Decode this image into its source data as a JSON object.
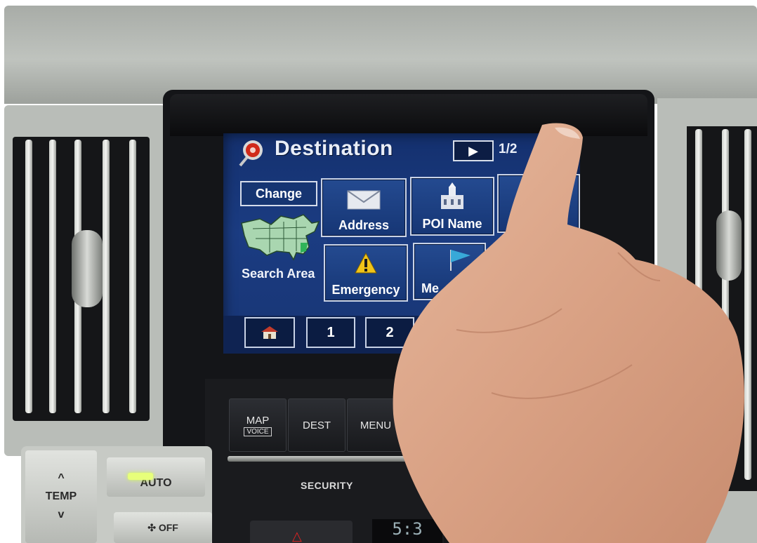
{
  "nav_screen": {
    "title": "Destination",
    "page_indicator": "1/2",
    "next_page_glyph": "▶",
    "change_label": "Change",
    "search_area_label": "Search Area",
    "buttons": [
      {
        "label": "Address",
        "icon": "envelope-icon"
      },
      {
        "label": "POI Name",
        "icon": "building-icon"
      },
      {
        "label": "",
        "icon": "obscured-icon"
      },
      {
        "label": "Emergency",
        "icon": "warning-icon"
      },
      {
        "label": "Me",
        "icon": "flag-icon"
      }
    ],
    "quick_buttons": [
      {
        "label": "",
        "icon": "home-icon"
      },
      {
        "label": "1"
      },
      {
        "label": "2"
      }
    ]
  },
  "hard_buttons": {
    "map": "MAP",
    "voice": "VOICE",
    "dest": "DEST",
    "menu": "MENU",
    "security": "SECURITY"
  },
  "climate": {
    "temp": "TEMP",
    "up": "^",
    "down": "v",
    "auto": "AUTO",
    "ac_off": "OFF"
  },
  "clock": "5:3",
  "colors": {
    "screen_bg": "#1b3c82",
    "button_border": "#c8d2e6",
    "text": "#ffffff",
    "warning": "#f0c419"
  }
}
